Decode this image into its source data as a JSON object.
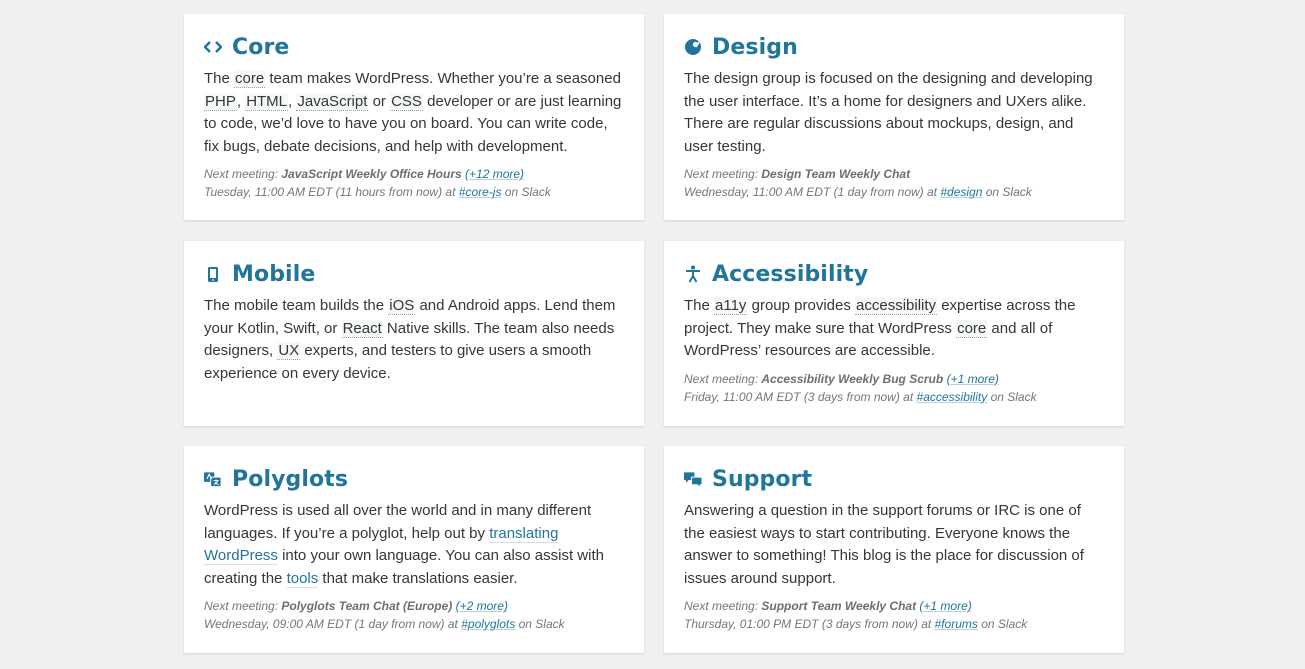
{
  "cards": {
    "core": {
      "title": "Core",
      "icon": "code-icon",
      "desc": {
        "t1": "The ",
        "a1": "core",
        "t2": " team makes WordPress. Whether you’re a seasoned ",
        "a2": "PHP",
        "t3": ", ",
        "a3": "HTML",
        "t4": ", ",
        "a4": "JavaScript",
        "t5": " or ",
        "a5": "CSS",
        "t6": " developer or are just learning to code, we’d love to have you on board. You can write code, fix bugs, debate decisions, and help with development."
      },
      "meeting": {
        "prefix": "Next meeting: ",
        "name": "JavaScript Weekly Office Hours",
        "more": "(+12 more)",
        "time": "Tuesday, 11:00 AM EDT (11 hours from now) at ",
        "channel": "#core-js",
        "suffix": " on Slack"
      }
    },
    "design": {
      "title": "Design",
      "icon": "palette-icon",
      "desc": "The design group is focused on the designing and developing the user interface. It’s a home for designers and UXers alike. There are regular discussions about mockups, design, and user testing.",
      "meeting": {
        "prefix": "Next meeting: ",
        "name": "Design Team Weekly Chat",
        "time": "Wednesday, 11:00 AM EDT (1 day from now) at ",
        "channel": "#design",
        "suffix": " on Slack"
      }
    },
    "mobile": {
      "title": "Mobile",
      "icon": "smartphone-icon",
      "desc": {
        "t1": "The mobile team builds the ",
        "a1": "iOS",
        "t2": " and Android apps. Lend them your Kotlin, Swift, or ",
        "a2": "React",
        "t3": " Native skills. The team also needs designers, ",
        "a3": "UX",
        "t4": " experts, and testers to give users a smooth experience on every device."
      }
    },
    "accessibility": {
      "title": "Accessibility",
      "icon": "universal-access-icon",
      "desc": {
        "t1": "The ",
        "a1": "a11y",
        "t2": " group provides ",
        "a2": "accessibility",
        "t3": " expertise across the project. They make sure that WordPress ",
        "a3": "core",
        "t4": " and all of WordPress’ resources are accessible."
      },
      "meeting": {
        "prefix": "Next meeting: ",
        "name": "Accessibility Weekly Bug Scrub",
        "more": "(+1 more)",
        "time": "Friday, 11:00 AM EDT (3 days from now) at ",
        "channel": "#accessibility",
        "suffix": " on Slack"
      }
    },
    "polyglots": {
      "title": "Polyglots",
      "icon": "translation-icon",
      "desc": {
        "t1": "WordPress is used all over the world and in many different languages. If you’re a polyglot, help out by ",
        "l1": "translating WordPress",
        "t2": " into your own language. You can also assist with creating the ",
        "l2": "tools",
        "t3": " that make translations easier."
      },
      "meeting": {
        "prefix": "Next meeting: ",
        "name": "Polyglots Team Chat (Europe)",
        "more": "(+2 more)",
        "time": "Wednesday, 09:00 AM EDT (1 day from now) at ",
        "channel": "#polyglots",
        "suffix": " on Slack"
      }
    },
    "support": {
      "title": "Support",
      "icon": "chat-bubbles-icon",
      "desc": "Answering a question in the support forums or IRC is one of the easiest ways to start contributing. Everyone knows the answer to something! This blog is the place for discussion of issues around support.",
      "meeting": {
        "prefix": "Next meeting: ",
        "name": "Support Team Weekly Chat",
        "more": "(+1 more)",
        "time": "Thursday, 01:00 PM EDT (3 days from now) at ",
        "channel": "#forums",
        "suffix": " on Slack"
      }
    }
  },
  "colors": {
    "accent": "#21759b",
    "background": "#f0f0f0",
    "card": "#ffffff",
    "text": "#32373c",
    "meta": "#72777c"
  }
}
